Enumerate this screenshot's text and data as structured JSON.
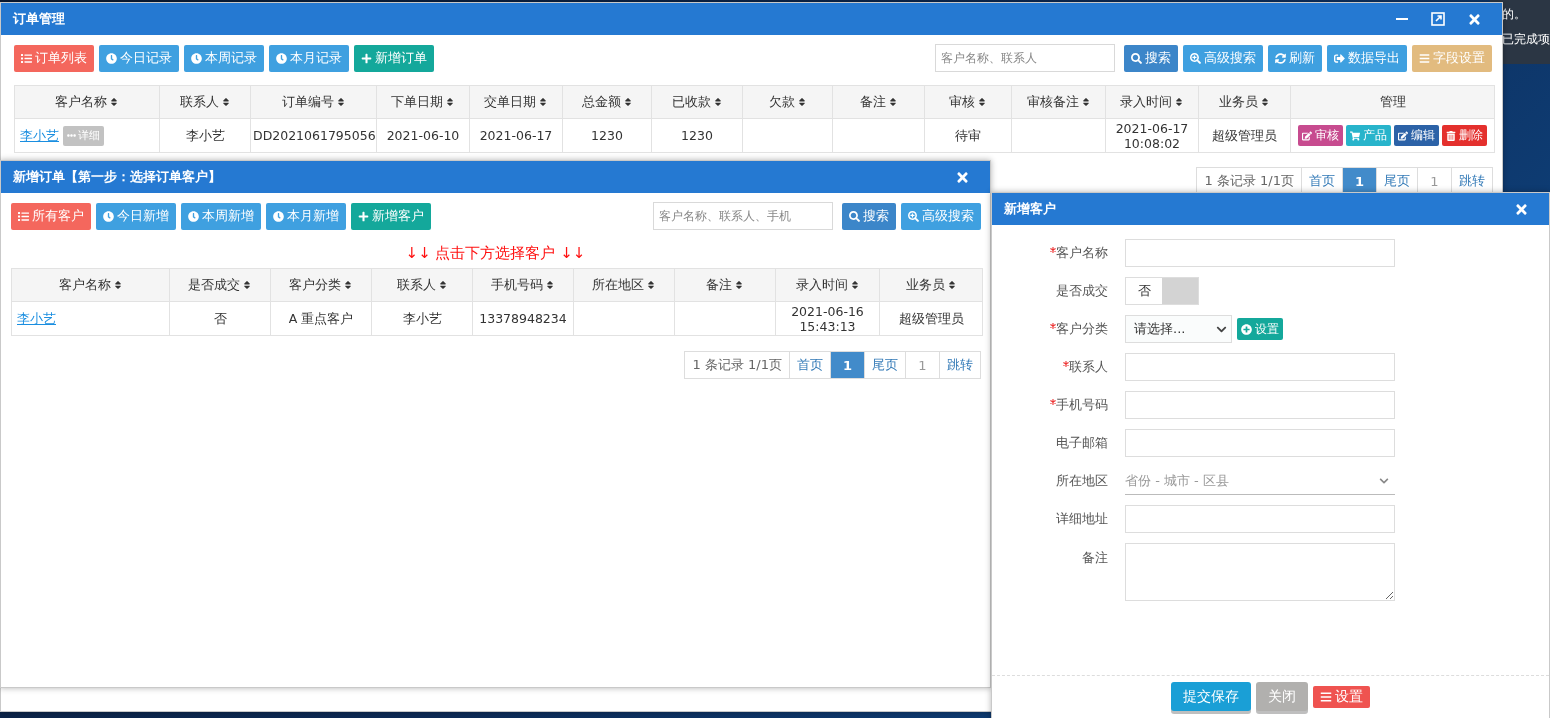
{
  "desktop": {
    "fragments": [
      "的。",
      "已完成项"
    ]
  },
  "main_window": {
    "title": "订单管理",
    "toolbar": [
      {
        "label": "订单列表"
      },
      {
        "label": "今日记录"
      },
      {
        "label": "本周记录"
      },
      {
        "label": "本月记录"
      },
      {
        "label": "新增订单"
      }
    ],
    "search": {
      "placeholder": "客户名称、联系人"
    },
    "actions": [
      {
        "label": "搜索"
      },
      {
        "label": "高级搜索"
      },
      {
        "label": "刷新"
      },
      {
        "label": "数据导出"
      },
      {
        "label": "字段设置"
      }
    ],
    "table": {
      "columns": [
        {
          "label": "客户名称",
          "sortable": true
        },
        {
          "label": "联系人",
          "sortable": true
        },
        {
          "label": "订单编号",
          "sortable": true
        },
        {
          "label": "下单日期",
          "sortable": true
        },
        {
          "label": "交单日期",
          "sortable": true
        },
        {
          "label": "总金额",
          "sortable": true
        },
        {
          "label": "已收款",
          "sortable": true
        },
        {
          "label": "欠款",
          "sortable": true
        },
        {
          "label": "备注",
          "sortable": true
        },
        {
          "label": "审核",
          "sortable": true
        },
        {
          "label": "审核备注",
          "sortable": true
        },
        {
          "label": "录入时间",
          "sortable": true
        },
        {
          "label": "业务员",
          "sortable": true
        },
        {
          "label": "管理",
          "sortable": false
        }
      ],
      "rows": [
        {
          "cells": [
            {
              "kind": "link",
              "text": "李小艺",
              "button": "详细"
            },
            "李小艺",
            "DD2021061795056",
            "2021-06-10",
            "2021-06-17",
            "1230",
            "1230",
            "",
            "",
            "待审",
            "",
            "2021-06-17 10:08:02",
            "超级管理员",
            {
              "kind": "actions",
              "buttons": [
                "审核",
                "产品",
                "编辑",
                "删除"
              ]
            }
          ]
        }
      ]
    },
    "pagination": {
      "summary": "1 条记录 1/1页",
      "first": "首页",
      "pages": [
        {
          "label": "1",
          "selected": true
        }
      ],
      "last": "尾页",
      "jump_value": "1",
      "jump": "跳转"
    }
  },
  "order_dialog": {
    "title": "新增订单【第一步：选择订单客户】",
    "toolbar": [
      {
        "label": "所有客户"
      },
      {
        "label": "今日新增"
      },
      {
        "label": "本周新增"
      },
      {
        "label": "本月新增"
      },
      {
        "label": "新增客户"
      }
    ],
    "search": {
      "placeholder": "客户名称、联系人、手机"
    },
    "actions": [
      {
        "label": "搜索"
      },
      {
        "label": "高级搜索"
      }
    ],
    "notice": "↓↓ 点击下方选择客户 ↓↓",
    "table": {
      "columns": [
        {
          "label": "客户名称",
          "sortable": true
        },
        {
          "label": "是否成交",
          "sortable": true
        },
        {
          "label": "客户分类",
          "sortable": true
        },
        {
          "label": "联系人",
          "sortable": true
        },
        {
          "label": "手机号码",
          "sortable": true
        },
        {
          "label": "所在地区",
          "sortable": true
        },
        {
          "label": "备注",
          "sortable": true
        },
        {
          "label": "录入时间",
          "sortable": true
        },
        {
          "label": "业务员",
          "sortable": true
        }
      ],
      "rows": [
        {
          "cells": [
            {
              "kind": "link",
              "text": "李小艺"
            },
            "否",
            "A 重点客户",
            "李小艺",
            "13378948234",
            "",
            "",
            "2021-06-16 15:43:13",
            "超级管理员"
          ]
        }
      ]
    },
    "pagination": {
      "summary": "1 条记录 1/1页",
      "first": "首页",
      "pages": [
        {
          "label": "1",
          "selected": true
        }
      ],
      "last": "尾页",
      "jump_value": "1",
      "jump": "跳转"
    }
  },
  "customer_dialog": {
    "title": "新增客户",
    "fields": [
      {
        "label": "客户名称",
        "required": true,
        "kind": "text"
      },
      {
        "label": "是否成交",
        "required": false,
        "kind": "toggle",
        "value": "否",
        "on": false
      },
      {
        "label": "客户分类",
        "required": true,
        "kind": "select",
        "value": "请选择...",
        "extra": "设置"
      },
      {
        "label": "联系人",
        "required": true,
        "kind": "text"
      },
      {
        "label": "手机号码",
        "required": true,
        "kind": "text"
      },
      {
        "label": "电子邮箱",
        "required": false,
        "kind": "text"
      },
      {
        "label": "所在地区",
        "required": false,
        "kind": "region",
        "placeholder": "省份 - 城市 - 区县"
      },
      {
        "label": "详细地址",
        "required": false,
        "kind": "text"
      },
      {
        "label": "备注",
        "required": false,
        "kind": "textarea"
      }
    ],
    "buttons": [
      {
        "label": "提交保存"
      },
      {
        "label": "关闭"
      },
      {
        "label": "设置"
      }
    ]
  }
}
